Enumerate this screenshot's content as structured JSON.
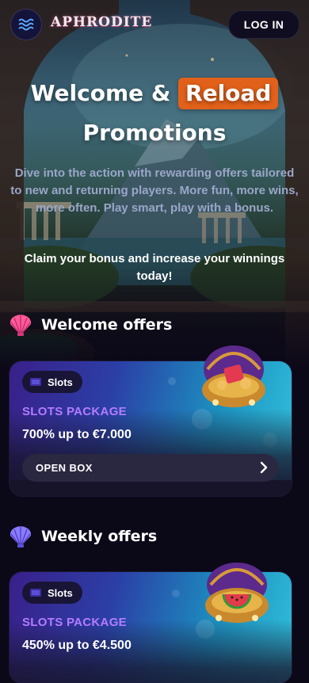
{
  "header": {
    "logo_text": "APHRODITE",
    "login_label": "LOG IN"
  },
  "hero": {
    "title_part1": "Welcome &",
    "title_highlight": "Reload",
    "title_part2": "Promotions",
    "subtitle": "Dive into the action with rewarding offers tailored to new and returning players. More fun, more wins, more often. Play smart, play with a bonus.",
    "claim": "Claim your bonus and increase your winnings today!"
  },
  "sections": [
    {
      "title": "Welcome offers",
      "icon": "pink-seashell-icon",
      "card": {
        "tag": "Slots",
        "package_title": "SLOTS PACKAGE",
        "amount": "700% up to €7.000",
        "button_label": "OPEN BOX"
      }
    },
    {
      "title": "Weekly offers",
      "icon": "blue-seashell-icon",
      "card": {
        "tag": "Slots",
        "package_title": "SLOTS PACKAGE",
        "amount": "450% up to €4.500"
      }
    }
  ],
  "colors": {
    "accent_orange": "#e2611a",
    "package_purple": "#b37cff",
    "page_background": "#0b0818"
  }
}
